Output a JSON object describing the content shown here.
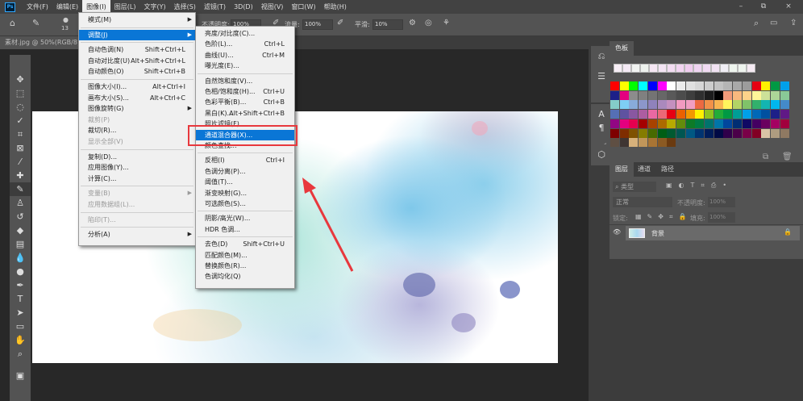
{
  "app": {
    "logo": "Ps"
  },
  "menubar": [
    "文件(F)",
    "编辑(E)",
    "图像(I)",
    "图层(L)",
    "文字(Y)",
    "选择(S)",
    "滤镜(T)",
    "3D(D)",
    "视图(V)",
    "窗口(W)",
    "帮助(H)"
  ],
  "window_controls": [
    "–",
    "⧉",
    "×"
  ],
  "options": {
    "brush_size": "13",
    "opacity_label": "不透明度:",
    "opacity": "100%",
    "flow_label": "流量:",
    "flow": "100%",
    "smooth_label": "平滑:",
    "smooth": "10%"
  },
  "document_tab": "素材.jpg @ 50%(RGB/8)",
  "image_menu": [
    {
      "label": "模式(M)",
      "submenu": true
    },
    {
      "sep": true
    },
    {
      "label": "调整(J)",
      "submenu": true,
      "highlight": true
    },
    {
      "sep": true
    },
    {
      "label": "自动色调(N)",
      "shortcut": "Shift+Ctrl+L"
    },
    {
      "label": "自动对比度(U)",
      "shortcut": "Alt+Shift+Ctrl+L"
    },
    {
      "label": "自动颜色(O)",
      "shortcut": "Shift+Ctrl+B"
    },
    {
      "sep": true
    },
    {
      "label": "图像大小(I)...",
      "shortcut": "Alt+Ctrl+I"
    },
    {
      "label": "画布大小(S)...",
      "shortcut": "Alt+Ctrl+C"
    },
    {
      "label": "图像旋转(G)",
      "submenu": true
    },
    {
      "label": "裁剪(P)",
      "disabled": true
    },
    {
      "label": "裁切(R)..."
    },
    {
      "label": "显示全部(V)",
      "disabled": true
    },
    {
      "sep": true
    },
    {
      "label": "复制(D)..."
    },
    {
      "label": "应用图像(Y)..."
    },
    {
      "label": "计算(C)..."
    },
    {
      "sep": true
    },
    {
      "label": "变量(B)",
      "submenu": true,
      "disabled": true
    },
    {
      "label": "应用数据组(L)...",
      "disabled": true
    },
    {
      "sep": true
    },
    {
      "label": "陷印(T)...",
      "disabled": true
    },
    {
      "sep": true
    },
    {
      "label": "分析(A)",
      "submenu": true
    }
  ],
  "adjust_menu": [
    {
      "label": "亮度/对比度(C)..."
    },
    {
      "label": "色阶(L)...",
      "shortcut": "Ctrl+L"
    },
    {
      "label": "曲线(U)...",
      "shortcut": "Ctrl+M"
    },
    {
      "label": "曝光度(E)..."
    },
    {
      "sep": true
    },
    {
      "label": "自然饱和度(V)..."
    },
    {
      "label": "色相/饱和度(H)...",
      "shortcut": "Ctrl+U"
    },
    {
      "label": "色彩平衡(B)...",
      "shortcut": "Ctrl+B"
    },
    {
      "label": "黑白(K)...",
      "shortcut": "Alt+Shift+Ctrl+B"
    },
    {
      "label": "照片滤镜(F)..."
    },
    {
      "label": "通道混合器(X)...",
      "highlight": true
    },
    {
      "label": "颜色查找..."
    },
    {
      "sep": true
    },
    {
      "label": "反相(I)",
      "shortcut": "Ctrl+I"
    },
    {
      "label": "色调分离(P)..."
    },
    {
      "label": "阈值(T)..."
    },
    {
      "label": "渐变映射(G)..."
    },
    {
      "label": "可选颜色(S)..."
    },
    {
      "sep": true
    },
    {
      "label": "阴影/高光(W)..."
    },
    {
      "label": "HDR 色调..."
    },
    {
      "sep": true
    },
    {
      "label": "去色(D)",
      "shortcut": "Shift+Ctrl+U"
    },
    {
      "label": "匹配颜色(M)..."
    },
    {
      "label": "替换颜色(R)..."
    },
    {
      "label": "色调均化(Q)"
    }
  ],
  "swatches_panel": {
    "tab": "色板",
    "recent": [
      "#f7eef6",
      "#f5eaf5",
      "#f2f4f2",
      "#eef2ee",
      "#f5e6f3",
      "#f4e4f4",
      "#f3dcf2",
      "#f2d4f1",
      "#f0ccef",
      "#f0d4f2",
      "#f1daf3",
      "#f1e2f3",
      "#f0eef5",
      "#eef5ee",
      "#eef4ee",
      "#f5eaf3"
    ],
    "colors": [
      "#ff0000",
      "#ffff00",
      "#00ff00",
      "#00ffff",
      "#0000ff",
      "#ff00ff",
      "#ffffff",
      "#ebebeb",
      "#e0e0e0",
      "#d6d6d6",
      "#cccccc",
      "#c2c2c2",
      "#b5b5b5",
      "#a8a8a8",
      "#9c9c9c",
      "#e60012",
      "#fff100",
      "#009944",
      "#00a0e9",
      "#1d2088",
      "#e4007f",
      "#8c8c8c",
      "#808080",
      "#747474",
      "#676767",
      "#595959",
      "#4c4c4c",
      "#3e3e3e",
      "#2f2f2f",
      "#1c1c1c",
      "#000000",
      "#f19c7a",
      "#f8b87e",
      "#fdd28a",
      "#fff799",
      "#cce198",
      "#acd598",
      "#89c997",
      "#84ccc9",
      "#7ecef4",
      "#88abda",
      "#8c97cb",
      "#8f82bc",
      "#aa89bd",
      "#c490bf",
      "#f29ac0",
      "#f19ec2",
      "#ec6941",
      "#f19149",
      "#f8b551",
      "#fff45c",
      "#b3d465",
      "#80c269",
      "#32b16c",
      "#13b5b1",
      "#00b7ee",
      "#448aca",
      "#556fb5",
      "#5f52a0",
      "#8957a1",
      "#ad5da1",
      "#ea68a2",
      "#eb6877",
      "#e60012",
      "#eb6100",
      "#f39800",
      "#fff100",
      "#8fc31f",
      "#22ac38",
      "#009944",
      "#009e96",
      "#00a0e9",
      "#0068b7",
      "#0050a0",
      "#1d2088",
      "#601986",
      "#920783",
      "#e4007f",
      "#e5004f",
      "#a40000",
      "#a84200",
      "#ac6a00",
      "#b7aa00",
      "#638c0b",
      "#0d7a27",
      "#007b43",
      "#00736d",
      "#0075a9",
      "#00479d",
      "#002e73",
      "#100964",
      "#440062",
      "#6a005f",
      "#a40062",
      "#a1003d",
      "#7e0000",
      "#7f2d00",
      "#7f5100",
      "#857c00",
      "#486a00",
      "#005e15",
      "#005a31",
      "#005652",
      "#005883",
      "#003471",
      "#001d5a",
      "#000a45",
      "#2f004a",
      "#4b0049",
      "#7a0048",
      "#820024",
      "#d9c3a5",
      "#ae9c80",
      "#8f7962",
      "#5f4f43",
      "#3f3532",
      "#d7b17b",
      "#c1965a",
      "#a87434",
      "#8b5a23",
      "#6a3a10"
    ]
  },
  "layers_panel": {
    "tabs": [
      "图层",
      "通道",
      "路径"
    ],
    "filter": "类型",
    "blend_mode": "正常",
    "opacity_label": "不透明度:",
    "opacity": "100%",
    "lock_label": "锁定:",
    "fill_label": "填充:",
    "fill": "100%",
    "layers": [
      {
        "name": "背景",
        "locked": true
      }
    ]
  },
  "accent": "#0a76d6",
  "annotation_color": "#e8383d"
}
